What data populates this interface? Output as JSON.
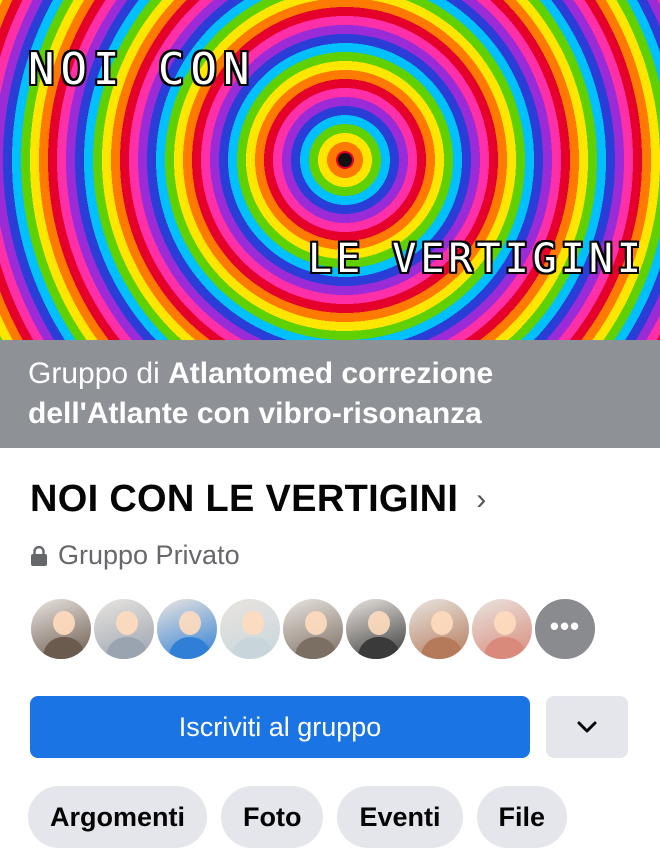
{
  "cover": {
    "text_line1": "NOI CON",
    "text_line2": "LE VERTIGINI"
  },
  "banner": {
    "prefix": "Gruppo di ",
    "name": "Atlantomed correzione dell'Atlante con vibro-risonanza"
  },
  "group": {
    "title": "NOI CON LE VERTIGINI",
    "title_chevron": "›",
    "privacy": "Gruppo Privato",
    "privacy_icon": "lock-icon"
  },
  "members": {
    "avatars": [
      {
        "name": "member-1",
        "color": "#6b5a4e"
      },
      {
        "name": "member-2",
        "color": "#9aa4b0"
      },
      {
        "name": "member-3",
        "color": "#2f7fd6"
      },
      {
        "name": "member-4",
        "color": "#c8d6dc"
      },
      {
        "name": "member-5",
        "color": "#7b6e63"
      },
      {
        "name": "member-6",
        "color": "#3a3a3a"
      },
      {
        "name": "member-7",
        "color": "#b47a5a"
      },
      {
        "name": "member-8",
        "color": "#d98a7a"
      }
    ],
    "more_label": "•••",
    "more_icon": "more-icon"
  },
  "actions": {
    "join_label": "Iscriviti al gruppo",
    "dropdown_icon": "chevron-down-icon",
    "accent": "#1b74e4"
  },
  "tabs": [
    {
      "label": "Argomenti"
    },
    {
      "label": "Foto"
    },
    {
      "label": "Eventi"
    },
    {
      "label": "File"
    }
  ]
}
